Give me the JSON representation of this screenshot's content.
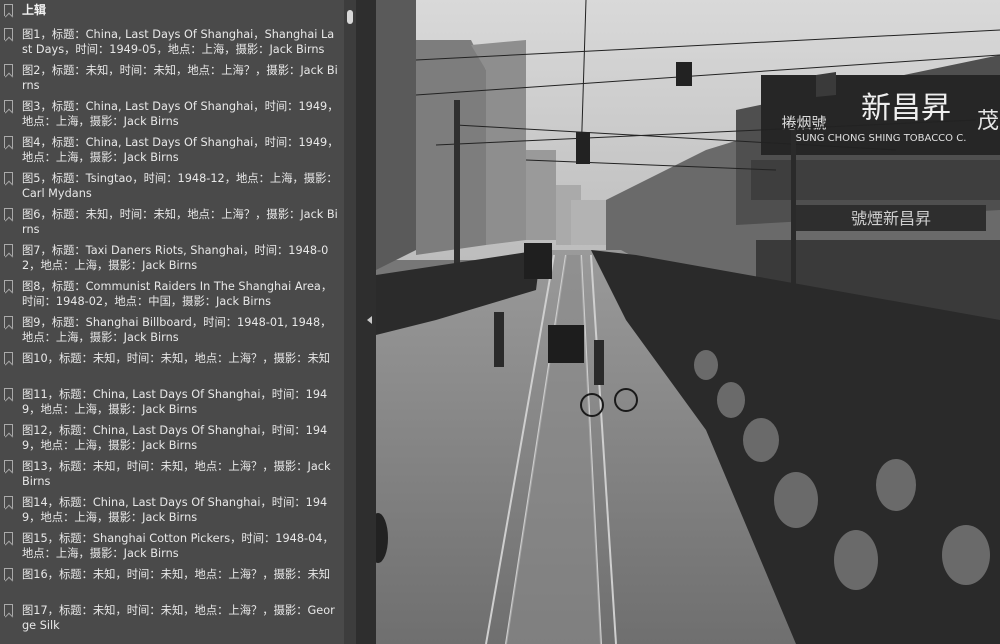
{
  "sidebar": {
    "header": "上辑",
    "items": [
      {
        "label": "图1，标题：China, Last Days Of Shanghai，Shanghai Last Days，时间：1949-05，地点：上海，摄影：Jack Birns"
      },
      {
        "label": "图2，标题：未知，时间：未知，地点：上海？，摄影：Jack Birns"
      },
      {
        "label": "图3，标题：China, Last Days Of Shanghai，时间：1949，地点：上海，摄影：Jack Birns"
      },
      {
        "label": "图4，标题：China, Last Days Of Shanghai，时间：1949，地点：上海，摄影：Jack Birns"
      },
      {
        "label": "图5，标题：Tsingtao，时间：1948-12，地点：上海，摄影：Carl Mydans"
      },
      {
        "label": "图6，标题：未知，时间：未知，地点：上海？，摄影：Jack Birns"
      },
      {
        "label": "图7，标题：Taxi Daners Riots, Shanghai，时间：1948-02，地点：上海，摄影：Jack Birns"
      },
      {
        "label": "图8，标题：Communist Raiders In The Shanghai Area，时间：1948-02，地点：中国，摄影：Jack Birns"
      },
      {
        "label": "图9，标题：Shanghai Billboard，时间：1948-01, 1948，地点：上海，摄影：Jack Birns"
      },
      {
        "label": "图10，标题：未知，时间：未知，地点：上海？，摄影：未知"
      },
      {
        "label": "图11，标题：China, Last Days Of Shanghai，时间：1949，地点：上海，摄影：Jack Birns"
      },
      {
        "label": "图12，标题：China, Last Days Of Shanghai，时间：1949，地点：上海，摄影：Jack Birns"
      },
      {
        "label": "图13，标题：未知，时间：未知，地点：上海？，摄影：Jack Birns"
      },
      {
        "label": "图14，标题：China, Last Days Of Shanghai，时间：1949，地点：上海，摄影：Jack Birns"
      },
      {
        "label": "图15，标题：Shanghai Cotton Pickers，时间：1948-04，地点：上海，摄影：Jack Birns"
      },
      {
        "label": "图16，标题：未知，时间：未知，地点：上海？，摄影：未知"
      },
      {
        "label": "图17，标题：未知，时间：未知，地点：上海？，摄影：George Silk"
      }
    ]
  },
  "photo": {
    "sign_main": "新昌昇",
    "sign_vertical": "捲烟號",
    "sign_english": "SUNG CHONG SHING TOBACCO C.",
    "sign_lower": "號煙新昌昇",
    "sign_edge": "茂"
  }
}
